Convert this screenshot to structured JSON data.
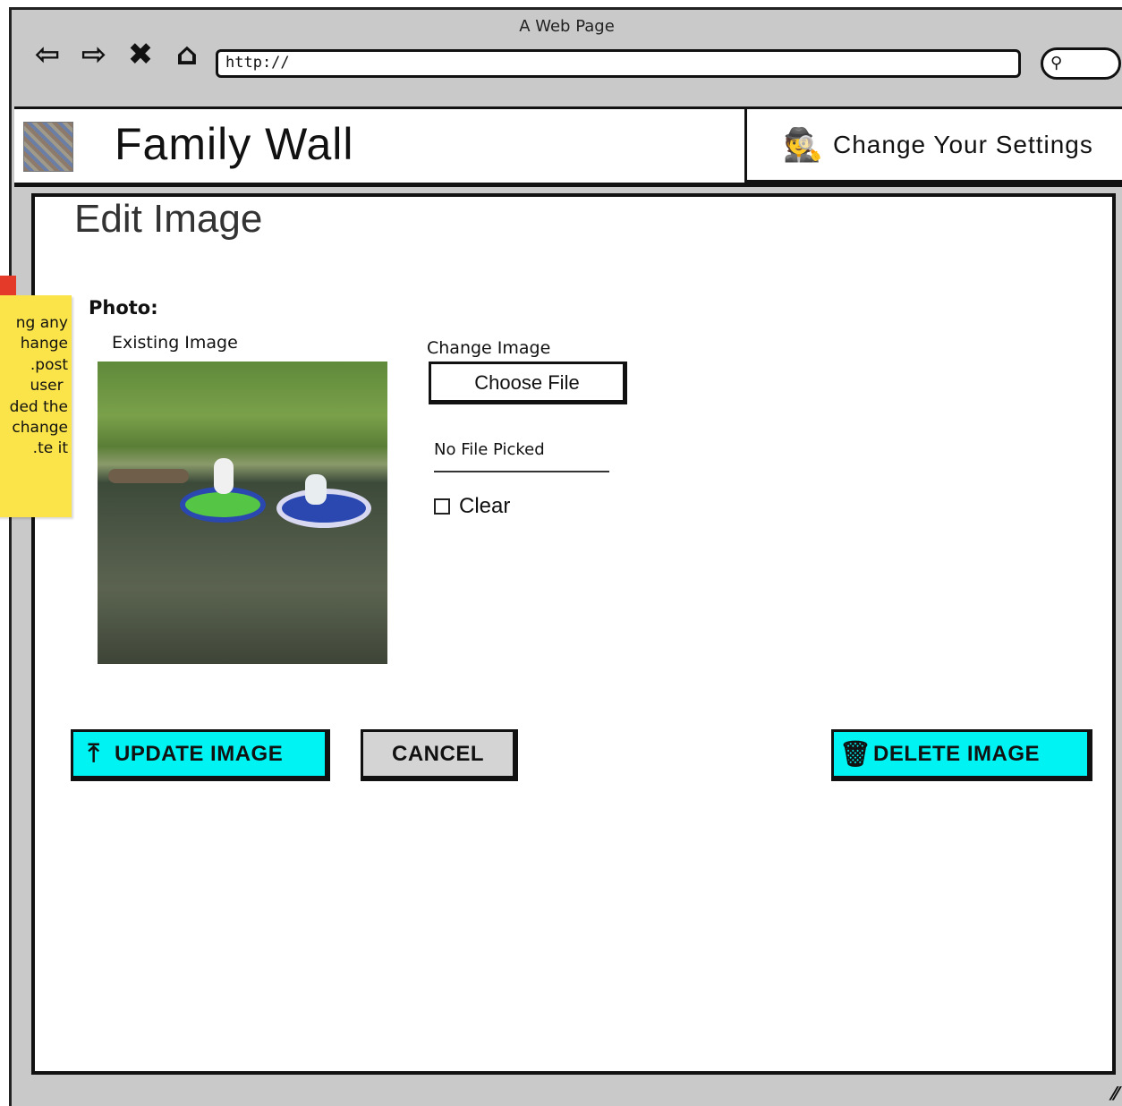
{
  "browser": {
    "title": "A Web Page",
    "url": "http://",
    "search_icon": "search-icon",
    "nav_icons": [
      "back-arrow-icon",
      "forward-arrow-icon",
      "close-icon",
      "home-icon"
    ]
  },
  "header": {
    "app_title": "Family Wall",
    "settings_label": "Change Your Settings",
    "settings_icon": "spy-icon"
  },
  "form": {
    "page_title": "Edit Image",
    "photo_label": "Photo:",
    "existing_label": "Existing Image",
    "change_label": "Change Image",
    "choose_file_label": "Choose File",
    "file_status": "No File Picked",
    "clear_label": "Clear"
  },
  "buttons": {
    "update_label": "UPDATE IMAGE",
    "update_icon": "upload-icon",
    "cancel_label": "CANCEL",
    "delete_label": "DELETE IMAGE",
    "delete_icon": "trash-icon",
    "accent_color": "#00f3f3",
    "cancel_color": "#d4d4d4"
  },
  "sticky_note": {
    "lines": [
      "ng any",
      "hange",
      "post.",
      " user",
      "ded the",
      "change",
      "te it."
    ],
    "color": "#fbe34a"
  }
}
